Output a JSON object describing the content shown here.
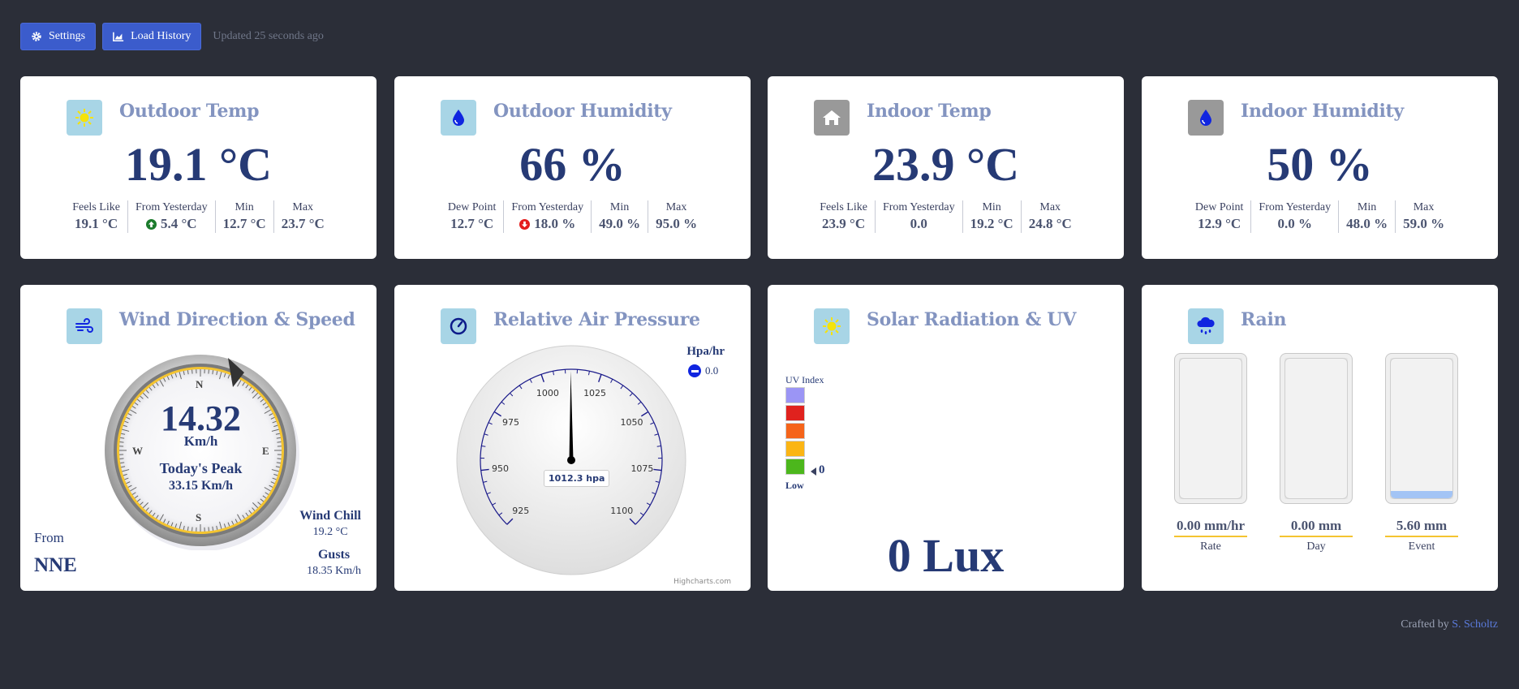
{
  "toolbar": {
    "settings_label": "Settings",
    "history_label": "Load History",
    "updated_text": "Updated 25 seconds ago"
  },
  "cards": {
    "outdoor_temp": {
      "title": "Outdoor Temp",
      "icon": "sun-icon",
      "value": "19.1 °C",
      "stats": [
        {
          "label": "Feels Like",
          "value": "19.1 °C"
        },
        {
          "label": "From Yesterday",
          "value": "5.4 °C",
          "trend": "up"
        },
        {
          "label": "Min",
          "value": "12.7 °C"
        },
        {
          "label": "Max",
          "value": "23.7 °C"
        }
      ]
    },
    "outdoor_humidity": {
      "title": "Outdoor Humidity",
      "icon": "droplet-icon",
      "value": "66 %",
      "stats": [
        {
          "label": "Dew Point",
          "value": "12.7 °C"
        },
        {
          "label": "From Yesterday",
          "value": "18.0 %",
          "trend": "down"
        },
        {
          "label": "Min",
          "value": "49.0 %"
        },
        {
          "label": "Max",
          "value": "95.0 %"
        }
      ]
    },
    "indoor_temp": {
      "title": "Indoor Temp",
      "icon": "home-icon",
      "value": "23.9 °C",
      "stats": [
        {
          "label": "Feels Like",
          "value": "23.9 °C"
        },
        {
          "label": "From Yesterday",
          "value": "0.0"
        },
        {
          "label": "Min",
          "value": "19.2 °C"
        },
        {
          "label": "Max",
          "value": "24.8 °C"
        }
      ]
    },
    "indoor_humidity": {
      "title": "Indoor Humidity",
      "icon": "droplet-icon",
      "value": "50 %",
      "stats": [
        {
          "label": "Dew Point",
          "value": "12.9 °C"
        },
        {
          "label": "From Yesterday",
          "value": "0.0 %"
        },
        {
          "label": "Min",
          "value": "48.0 %"
        },
        {
          "label": "Max",
          "value": "59.0 %"
        }
      ]
    },
    "wind": {
      "title": "Wind Direction & Speed",
      "icon": "wind-icon",
      "speed": "14.32",
      "unit": "Km/h",
      "peak_label": "Today's Peak",
      "peak_value": "33.15 Km/h",
      "directions": {
        "n": "N",
        "e": "E",
        "s": "S",
        "w": "W"
      },
      "from_label": "From",
      "from_value": "NNE",
      "wind_chill_label": "Wind Chill",
      "wind_chill_value": "19.2 °C",
      "gusts_label": "Gusts",
      "gusts_value": "18.35 Km/h"
    },
    "pressure": {
      "title": "Relative Air Pressure",
      "icon": "gauge-icon",
      "value": 1012.3,
      "value_label": "1012.3 hpa",
      "ticks": [
        "925",
        "950",
        "975",
        "1000",
        "1025",
        "1050",
        "1075",
        "1100"
      ],
      "trend_label": "Hpa/hr",
      "trend_value": "0.0",
      "credit": "Highcharts.com"
    },
    "solar": {
      "title": "Solar Radiation & UV",
      "icon": "sun-icon",
      "uv_label": "UV Index",
      "uv_low_label": "Low",
      "uv_value": "0",
      "uv_colors": [
        "#9b95f5",
        "#e0221e",
        "#f5641a",
        "#fbb514",
        "#4cb71c"
      ],
      "lux": "0 Lux"
    },
    "rain": {
      "title": "Rain",
      "icon": "rain-cloud-icon",
      "gauges": [
        {
          "value": "0.00 mm/hr",
          "label": "Rate",
          "fill": 0
        },
        {
          "value": "0.00 mm",
          "label": "Day",
          "fill": 0
        },
        {
          "value": "5.60 mm",
          "label": "Event",
          "fill": 0.05
        }
      ]
    }
  },
  "footer": {
    "crafted_by": "Crafted by",
    "author": "S. Scholtz"
  }
}
